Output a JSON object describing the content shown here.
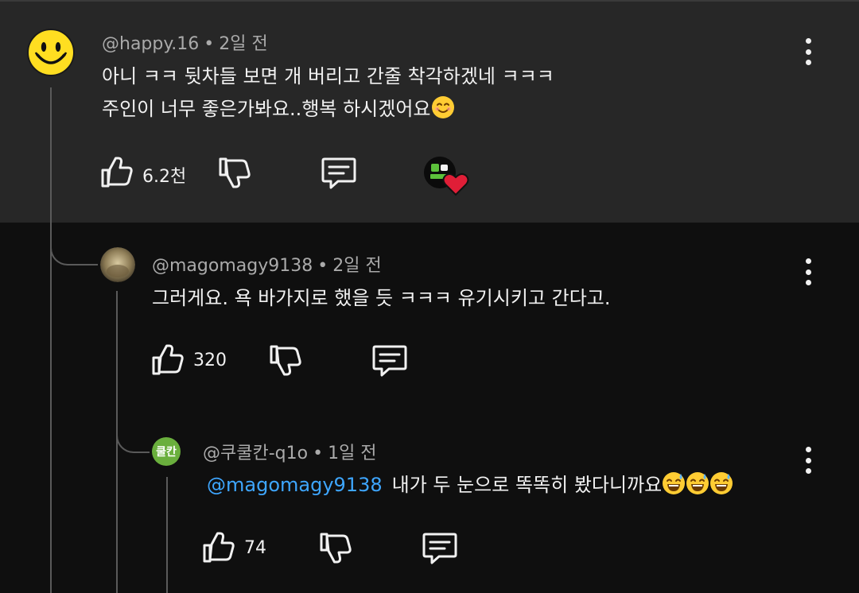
{
  "comments": [
    {
      "handle": "@happy.16",
      "time": "2일 전",
      "lines": [
        "아니 ㅋㅋ 뒷차들 보면 개 버리고 간줄 착각하겠네 ㅋㅋㅋ",
        "주인이 너무 좋은가봐요..행복 하시겠어요"
      ],
      "like_count": "6.2천",
      "creator_heart": "heart-red"
    },
    {
      "handle": "@magomagy9138",
      "time": "2일 전",
      "lines": [
        "그러게요. 욕 바가지로 했을 듯 ㅋㅋㅋ 유기시키고 간다고."
      ],
      "like_count": "320"
    },
    {
      "handle": "@쿠쿨칸-q1o",
      "time": "1일 전",
      "avatar_text": "쿨칸",
      "mention": "@magomagy9138",
      "text": "내가 두 눈으로 똑똑히 봤다니까요",
      "like_count": "74"
    }
  ],
  "dot": "•",
  "colors": {
    "pinned_bg": "#272727",
    "bg": "#0f0f0f",
    "mention": "#3ea6ff",
    "avatar_green": "#6aaf3d"
  }
}
